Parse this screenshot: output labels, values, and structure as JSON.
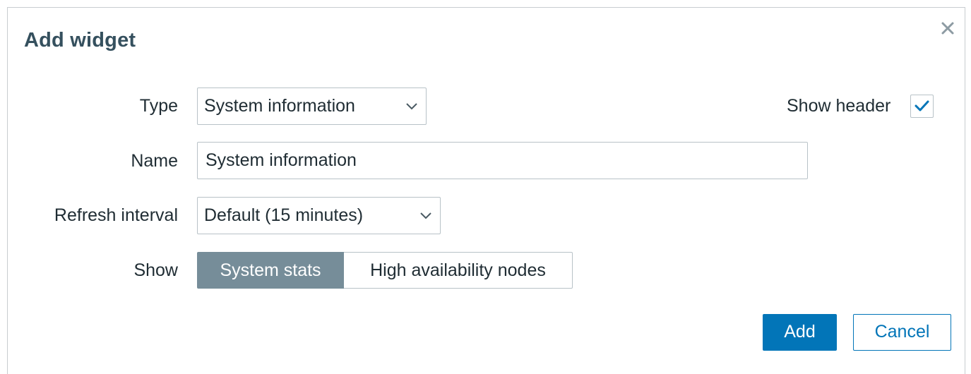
{
  "dialog": {
    "title": "Add widget",
    "close_icon": "close-icon"
  },
  "form": {
    "type": {
      "label": "Type",
      "value": "System information",
      "icon": "chevron-down-icon"
    },
    "show_header": {
      "label": "Show header",
      "checked": true,
      "icon": "checkmark-icon"
    },
    "name": {
      "label": "Name",
      "value": "System information",
      "placeholder": "default"
    },
    "refresh_interval": {
      "label": "Refresh interval",
      "value": "Default (15 minutes)",
      "icon": "chevron-down-icon"
    },
    "show": {
      "label": "Show",
      "options": [
        {
          "label": "System stats",
          "selected": true
        },
        {
          "label": "High availability nodes",
          "selected": false
        }
      ]
    }
  },
  "footer": {
    "add_label": "Add",
    "cancel_label": "Cancel"
  },
  "colors": {
    "title": "#35505e",
    "primary": "#0275b8",
    "segment_active": "#768d99",
    "border": "#b8c2c7",
    "text": "#1f2c33"
  }
}
